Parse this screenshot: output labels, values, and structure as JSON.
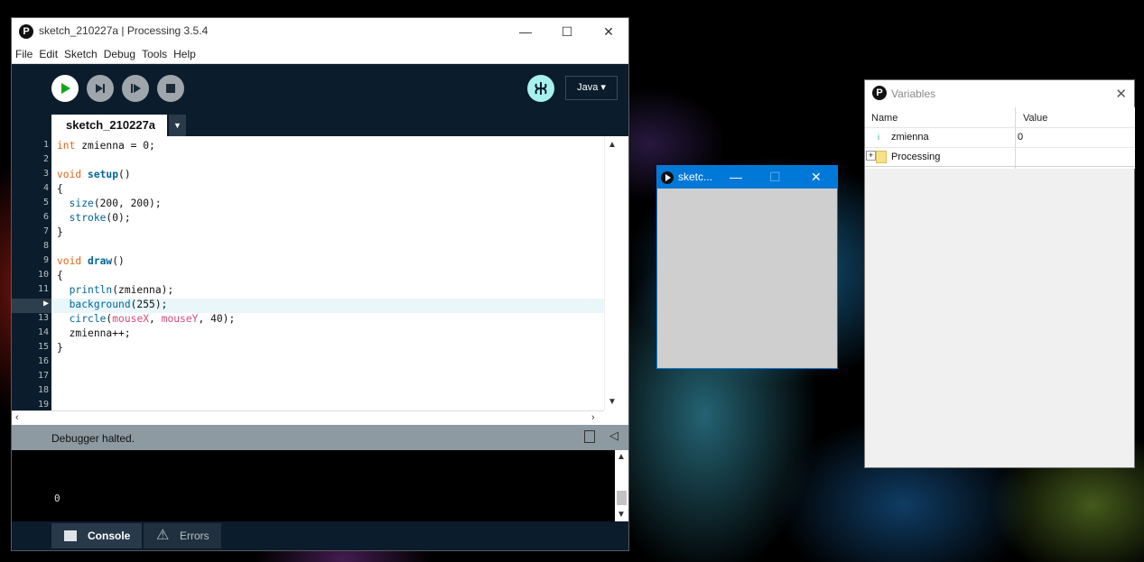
{
  "ide": {
    "title": "sketch_210227a | Processing 3.5.4",
    "menu": [
      "File",
      "Edit",
      "Sketch",
      "Debug",
      "Tools",
      "Help"
    ],
    "mode": "Java ▾",
    "tab": "sketch_210227a",
    "status": "Debugger halted.",
    "console_output": "0",
    "console_tab": "Console",
    "errors_tab": "Errors",
    "line_numbers": [
      "1",
      "2",
      "3",
      "4",
      "5",
      "6",
      "7",
      "8",
      "9",
      "10",
      "11",
      "12",
      "13",
      "14",
      "15",
      "16",
      "17",
      "18",
      "19"
    ],
    "code": [
      "int zmienna = 0;",
      "",
      "void setup()",
      "{",
      "  size(200, 200);",
      "  stroke(0);",
      "}",
      "",
      "void draw()",
      "{",
      "  println(zmienna);",
      "  background(255);",
      "  circle(mouseX, mouseY, 40);",
      "  zmienna++;",
      "}"
    ],
    "current_line": 12,
    "colors": {
      "toolbar": "#0b1c2c",
      "debug": "#a8f0f0",
      "keyword": "#e2661a",
      "function": "#006699",
      "builtin_var": "#d94a7a"
    }
  },
  "sketch_window": {
    "title": "sketc..."
  },
  "variables": {
    "title": "Variables",
    "columns": [
      "Name",
      "Value"
    ],
    "rows": [
      {
        "name": "zmienna",
        "value": "0"
      },
      {
        "name": "Processing",
        "value": ""
      }
    ]
  }
}
